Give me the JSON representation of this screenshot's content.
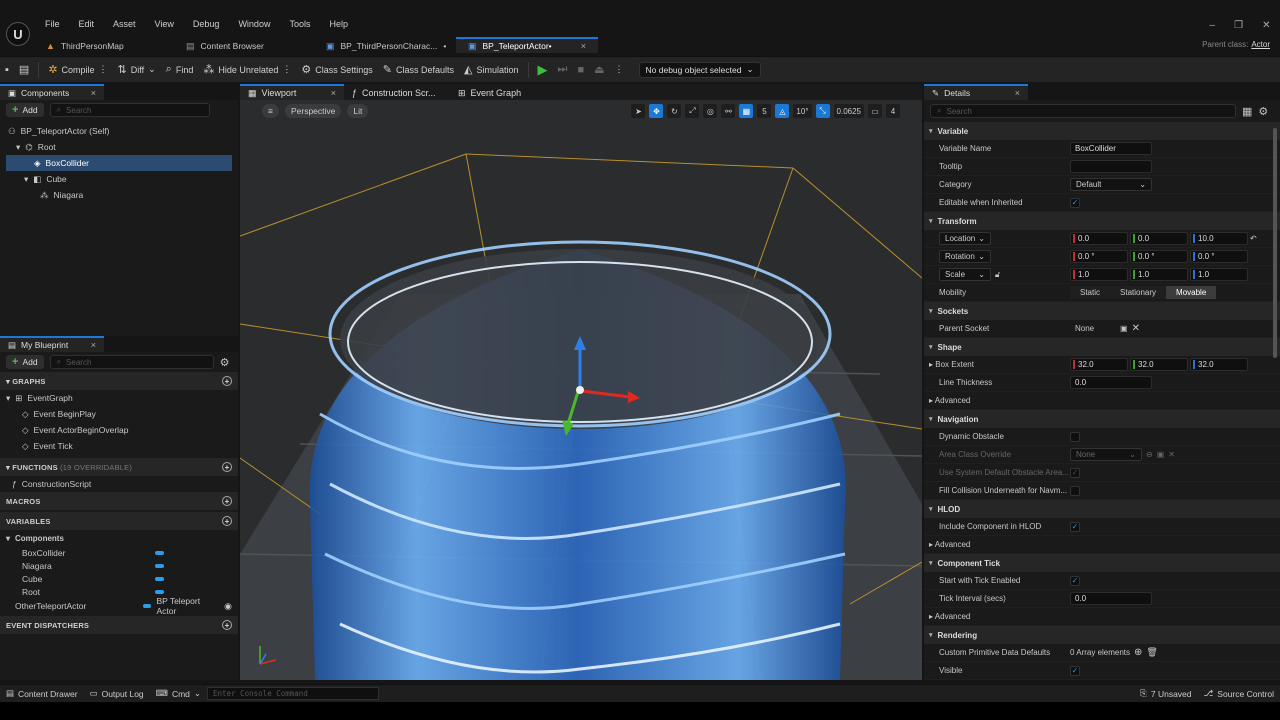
{
  "menu": [
    "File",
    "Edit",
    "Asset",
    "View",
    "Debug",
    "Window",
    "Tools",
    "Help"
  ],
  "doc_tabs": [
    {
      "label": "ThirdPersonMap",
      "icon": "map-icon"
    },
    {
      "label": "Content Browser",
      "icon": "folder-icon"
    },
    {
      "label": "BP_ThirdPersonCharac...",
      "icon": "blueprint-icon",
      "modified": "•"
    },
    {
      "label": "BP_TeleportActor•",
      "icon": "blueprint-icon",
      "active": true,
      "close": "×"
    }
  ],
  "parent_class": {
    "label": "Parent class:",
    "value": "Actor"
  },
  "window_controls": [
    "–",
    "❐",
    "✕"
  ],
  "toolbar": {
    "compile": "Compile",
    "diff": "Diff",
    "find": "Find",
    "hide_unrelated": "Hide Unrelated",
    "class_settings": "Class Settings",
    "class_defaults": "Class Defaults",
    "simulation": "Simulation",
    "debug_object": "No debug object selected"
  },
  "components_panel": {
    "tab": "Components",
    "add": "Add",
    "search_placeholder": "Search",
    "tree": [
      {
        "label": "BP_TeleportActor (Self)",
        "indent": 0
      },
      {
        "label": "Root",
        "indent": 1
      },
      {
        "label": "BoxCollider",
        "indent": 2,
        "selected": true
      },
      {
        "label": "Cube",
        "indent": 1
      },
      {
        "label": "Niagara",
        "indent": 2
      }
    ]
  },
  "my_blueprint": {
    "tab": "My Blueprint",
    "add": "Add",
    "search_placeholder": "Search",
    "graphs_header": "GRAPHS",
    "event_graph": "EventGraph",
    "events": [
      "Event BeginPlay",
      "Event ActorBeginOverlap",
      "Event Tick"
    ],
    "functions_header": "FUNCTIONS",
    "functions_note": "(19 OVERRIDABLE)",
    "functions": [
      "ConstructionScript"
    ],
    "macros_header": "MACROS",
    "variables_header": "VARIABLES",
    "components_group": "Components",
    "component_vars": [
      "BoxCollider",
      "Niagara",
      "Cube",
      "Root"
    ],
    "other_var": {
      "name": "OtherTeleportActor",
      "type": "BP Teleport Actor"
    },
    "dispatchers_header": "EVENT DISPATCHERS"
  },
  "viewport": {
    "tabs": [
      "Viewport",
      "Construction Scr...",
      "Event Graph"
    ],
    "perspective": "Perspective",
    "lit": "Lit",
    "grid_snap": "5",
    "rot_snap": "10°",
    "scale_snap": "0.0625",
    "cam_speed": "4"
  },
  "details": {
    "tab": "Details",
    "search_placeholder": "Search",
    "variable_header": "Variable",
    "variable_name_label": "Variable Name",
    "variable_name": "BoxCollider",
    "tooltip_label": "Tooltip",
    "category_label": "Category",
    "category": "Default",
    "editable_label": "Editable when Inherited",
    "transform_header": "Transform",
    "location_label": "Location",
    "location": [
      "0.0",
      "0.0",
      "10.0"
    ],
    "rotation_label": "Rotation",
    "rotation": [
      "0.0 °",
      "0.0 °",
      "0.0 °"
    ],
    "scale_label": "Scale",
    "scale": [
      "1.0",
      "1.0",
      "1.0"
    ],
    "mobility_label": "Mobility",
    "mobility": [
      "Static",
      "Stationary",
      "Movable"
    ],
    "sockets_header": "Sockets",
    "parent_socket_label": "Parent Socket",
    "parent_socket": "None",
    "shape_header": "Shape",
    "box_extent_label": "Box Extent",
    "box_extent": [
      "32.0",
      "32.0",
      "32.0"
    ],
    "line_thickness_label": "Line Thickness",
    "line_thickness": "0.0",
    "advanced": "Advanced",
    "navigation_header": "Navigation",
    "dynamic_obstacle_label": "Dynamic Obstacle",
    "area_class_label": "Area Class Override",
    "area_class": "None",
    "use_default_label": "Use System Default Obstacle Area...",
    "fill_collision_label": "Fill Collision Underneath for Navm...",
    "hlod_header": "HLOD",
    "include_hlod_label": "Include Component in HLOD",
    "tick_header": "Component Tick",
    "start_tick_label": "Start with Tick Enabled",
    "tick_interval_label": "Tick Interval (secs)",
    "tick_interval": "0.0",
    "rendering_header": "Rendering",
    "custom_prim_label": "Custom Primitive Data Defaults",
    "custom_prim": "0 Array elements",
    "visible_label": "Visible"
  },
  "status": {
    "content_drawer": "Content Drawer",
    "output_log": "Output Log",
    "cmd": "Cmd",
    "console_placeholder": "Enter Console Command",
    "unsaved": "7 Unsaved",
    "source_control": "Source Control"
  }
}
